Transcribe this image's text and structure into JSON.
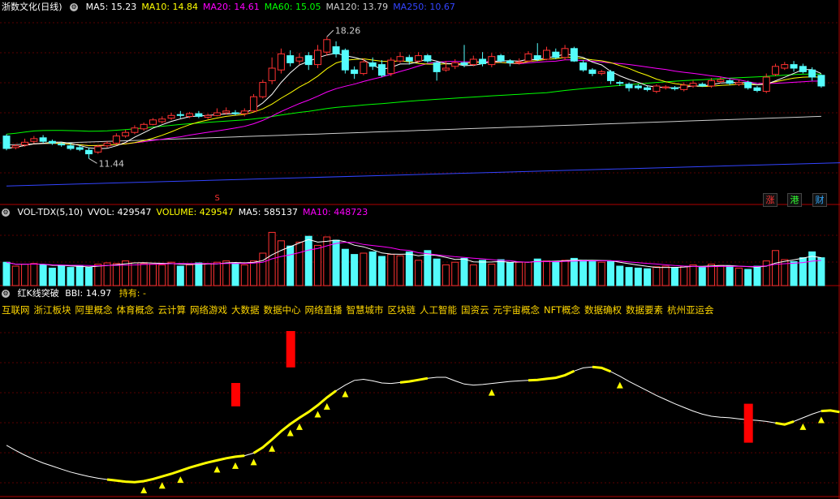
{
  "header": {
    "stock_name": "浙数文化(日线)",
    "ma_labels": [
      {
        "text": "MA5: 15.23",
        "color": "#ffffff"
      },
      {
        "text": "MA10: 14.84",
        "color": "#ffff00"
      },
      {
        "text": "MA20: 14.61",
        "color": "#ff00ff"
      },
      {
        "text": "MA60: 15.05",
        "color": "#00ff00"
      },
      {
        "text": "MA120: 13.79",
        "color": "#cccccc"
      },
      {
        "text": "MA250: 10.67",
        "color": "#3344ff"
      }
    ]
  },
  "volume_header": {
    "title": "VOL-TDX(5,10)",
    "labels": [
      {
        "text": "VVOL: 429547",
        "color": "#ffffff"
      },
      {
        "text": "VOLUME: 429547",
        "color": "#ffff00"
      },
      {
        "text": "MA5: 585137",
        "color": "#ffffff"
      },
      {
        "text": "MA10: 448723",
        "color": "#ff00ff"
      }
    ]
  },
  "indicator_header": {
    "title": "红K线突破",
    "bbi": "BBI: 14.97",
    "hold": "持有: -"
  },
  "concepts": [
    "互联网",
    "浙江板块",
    "阿里概念",
    "体育概念",
    "云计算",
    "网络游戏",
    "大数据",
    "数据中心",
    "网络直播",
    "智慧城市",
    "区块链",
    "人工智能",
    "国资云",
    "元宇宙概念",
    "NFT概念",
    "数据确权",
    "数据要素",
    "杭州亚运会"
  ],
  "annotations": {
    "high": "18.26",
    "low": "11.44",
    "s_marker": "S"
  },
  "badges": [
    {
      "text": "涨",
      "color": "#ff3333"
    },
    {
      "text": "港",
      "color": "#33ff33"
    },
    {
      "text": "财",
      "color": "#33aaff"
    }
  ],
  "chart_data": {
    "type": "candlestick",
    "price_range": [
      9.5,
      19.5
    ],
    "candles": [
      [
        12.7,
        12.0,
        12.8,
        11.9
      ],
      [
        12.05,
        12.15,
        12.25,
        11.95
      ],
      [
        12.2,
        12.35,
        12.55,
        12.1
      ],
      [
        12.4,
        12.55,
        12.7,
        12.3
      ],
      [
        12.6,
        12.4,
        12.75,
        12.3
      ],
      [
        12.4,
        12.3,
        12.5,
        12.2
      ],
      [
        12.25,
        12.2,
        12.35,
        12.1
      ],
      [
        12.15,
        12.0,
        12.3,
        11.9
      ],
      [
        12.05,
        11.95,
        12.2,
        11.85
      ],
      [
        11.9,
        11.7,
        12.05,
        11.44
      ],
      [
        11.8,
        12.1,
        12.2,
        11.7
      ],
      [
        12.15,
        12.3,
        12.4,
        12.05
      ],
      [
        12.3,
        12.7,
        12.85,
        12.2
      ],
      [
        12.7,
        12.9,
        13.05,
        12.6
      ],
      [
        12.9,
        13.15,
        13.3,
        12.8
      ],
      [
        13.1,
        13.35,
        13.45,
        13.0
      ],
      [
        13.35,
        13.6,
        13.7,
        13.3
      ],
      [
        13.5,
        13.65,
        13.8,
        13.4
      ],
      [
        13.7,
        13.85,
        14.0,
        13.6
      ],
      [
        13.9,
        13.85,
        14.1,
        13.7
      ],
      [
        13.8,
        13.95,
        14.05,
        13.7
      ],
      [
        13.95,
        13.8,
        14.1,
        13.7
      ],
      [
        13.75,
        13.85,
        13.95,
        13.65
      ],
      [
        13.85,
        14.0,
        14.25,
        13.8
      ],
      [
        14.0,
        14.1,
        14.3,
        13.9
      ],
      [
        14.0,
        13.95,
        14.15,
        13.85
      ],
      [
        13.95,
        14.1,
        14.25,
        13.8
      ],
      [
        14.1,
        14.9,
        15.05,
        14.0
      ],
      [
        14.9,
        15.7,
        15.85,
        14.8
      ],
      [
        15.8,
        16.5,
        17.1,
        15.6
      ],
      [
        16.4,
        17.3,
        17.6,
        16.2
      ],
      [
        17.2,
        16.8,
        17.5,
        16.6
      ],
      [
        16.9,
        17.1,
        17.35,
        16.7
      ],
      [
        17.2,
        16.7,
        17.4,
        16.4
      ],
      [
        16.7,
        17.5,
        17.8,
        16.5
      ],
      [
        17.4,
        18.1,
        18.26,
        17.2
      ],
      [
        17.7,
        17.3,
        18.0,
        17.1
      ],
      [
        17.5,
        16.4,
        17.6,
        16.2
      ],
      [
        16.4,
        16.2,
        16.6,
        15.9
      ],
      [
        16.2,
        16.85,
        17.05,
        16.1
      ],
      [
        16.8,
        16.6,
        17.1,
        16.4
      ],
      [
        16.7,
        16.1,
        16.95,
        16.0
      ],
      [
        16.2,
        16.95,
        17.1,
        16.05
      ],
      [
        16.9,
        17.15,
        17.4,
        16.8
      ],
      [
        17.1,
        16.9,
        17.25,
        16.7
      ],
      [
        16.9,
        17.2,
        17.4,
        16.8
      ],
      [
        17.2,
        16.9,
        17.3,
        16.8
      ],
      [
        16.8,
        16.3,
        16.9,
        15.8
      ],
      [
        16.4,
        16.5,
        16.9,
        16.3
      ],
      [
        16.6,
        16.8,
        17.0,
        16.45
      ],
      [
        16.8,
        16.7,
        17.8,
        16.55
      ],
      [
        16.7,
        17.0,
        17.2,
        16.6
      ],
      [
        17.0,
        16.75,
        17.4,
        16.6
      ],
      [
        16.7,
        17.15,
        17.35,
        16.55
      ],
      [
        17.2,
        16.9,
        17.3,
        16.8
      ],
      [
        16.9,
        16.8,
        17.0,
        16.6
      ],
      [
        16.8,
        16.85,
        17.05,
        16.7
      ],
      [
        16.9,
        17.3,
        17.45,
        16.85
      ],
      [
        17.2,
        17.0,
        17.9,
        16.9
      ],
      [
        17.0,
        17.5,
        17.7,
        16.95
      ],
      [
        17.4,
        17.1,
        17.6,
        17.0
      ],
      [
        17.1,
        17.6,
        17.8,
        16.95
      ],
      [
        17.6,
        16.9,
        17.7,
        16.85
      ],
      [
        16.8,
        16.4,
        16.95,
        16.3
      ],
      [
        16.4,
        16.2,
        16.5,
        16.05
      ],
      [
        16.2,
        16.3,
        16.4,
        16.1
      ],
      [
        16.3,
        15.8,
        16.4,
        15.6
      ],
      [
        15.7,
        15.65,
        15.8,
        15.5
      ],
      [
        15.6,
        15.4,
        15.7,
        15.2
      ],
      [
        15.5,
        15.4,
        15.6,
        15.3
      ],
      [
        15.4,
        15.3,
        15.5,
        15.2
      ],
      [
        15.2,
        15.5,
        15.6,
        15.1
      ],
      [
        15.4,
        15.45,
        15.55,
        15.3
      ],
      [
        15.4,
        15.35,
        15.5,
        15.25
      ],
      [
        15.3,
        15.55,
        15.7,
        15.2
      ],
      [
        15.5,
        15.65,
        15.8,
        15.4
      ],
      [
        15.6,
        15.5,
        15.7,
        15.45
      ],
      [
        15.5,
        15.8,
        15.95,
        15.4
      ],
      [
        15.75,
        15.85,
        16.0,
        15.65
      ],
      [
        15.8,
        15.65,
        15.9,
        15.55
      ],
      [
        15.6,
        15.7,
        15.85,
        15.5
      ],
      [
        15.7,
        15.4,
        15.8,
        15.3
      ],
      [
        15.4,
        15.25,
        15.5,
        15.15
      ],
      [
        15.2,
        16.0,
        16.2,
        15.1
      ],
      [
        16.15,
        16.6,
        16.75,
        16.05
      ],
      [
        16.5,
        16.7,
        16.85,
        16.4
      ],
      [
        16.7,
        16.5,
        16.9,
        16.3
      ],
      [
        16.6,
        16.3,
        16.75,
        16.2
      ],
      [
        16.4,
        16.0,
        16.55,
        15.8
      ],
      [
        16.1,
        15.5,
        16.15,
        15.4
      ]
    ],
    "ma250": [
      9.9,
      11.2
    ],
    "volume_range": [
      0,
      1000000
    ],
    "volume": [
      360000,
      300000,
      330000,
      340000,
      320000,
      270000,
      300000,
      280000,
      310000,
      280000,
      330000,
      350000,
      340000,
      380000,
      350000,
      340000,
      330000,
      320000,
      360000,
      300000,
      320000,
      350000,
      340000,
      360000,
      380000,
      350000,
      320000,
      380000,
      500000,
      820000,
      690000,
      610000,
      670000,
      760000,
      620000,
      750000,
      700000,
      560000,
      480000,
      500000,
      520000,
      450000,
      480000,
      460000,
      520000,
      390000,
      540000,
      410000,
      320000,
      360000,
      420000,
      320000,
      390000,
      330000,
      400000,
      350000,
      360000,
      360000,
      410000,
      380000,
      370000,
      390000,
      420000,
      390000,
      380000,
      360000,
      370000,
      300000,
      280000,
      270000,
      260000,
      290000,
      300000,
      280000,
      300000,
      320000,
      290000,
      330000,
      310000,
      300000,
      270000,
      250000,
      300000,
      380000,
      540000,
      400000,
      370000,
      430000,
      520000,
      429547
    ],
    "bbi_range": [
      13.0,
      19.5
    ],
    "bbi": [
      14.6,
      14.4,
      14.22,
      14.06,
      13.92,
      13.8,
      13.68,
      13.57,
      13.48,
      13.4,
      13.33,
      13.28,
      13.24,
      13.2,
      13.18,
      13.22,
      13.3,
      13.4,
      13.5,
      13.62,
      13.74,
      13.84,
      13.94,
      14.02,
      14.1,
      14.16,
      14.2,
      14.3,
      14.52,
      14.82,
      15.14,
      15.42,
      15.66,
      15.88,
      16.14,
      16.44,
      16.7,
      16.92,
      17.1,
      17.14,
      17.08,
      17.0,
      16.98,
      17.02,
      17.06,
      17.12,
      17.18,
      17.22,
      17.22,
      17.08,
      16.96,
      16.92,
      16.94,
      16.98,
      17.02,
      17.06,
      17.08,
      17.1,
      17.12,
      17.16,
      17.2,
      17.3,
      17.46,
      17.58,
      17.62,
      17.58,
      17.44,
      17.26,
      17.06,
      16.88,
      16.7,
      16.52,
      16.36,
      16.2,
      16.06,
      15.92,
      15.8,
      15.72,
      15.68,
      15.66,
      15.62,
      15.58,
      15.56,
      15.52,
      15.46,
      15.4,
      15.52,
      15.66,
      15.8,
      15.92,
      15.94,
      15.88
    ],
    "hold_segments": [
      [
        11,
        26
      ],
      [
        27,
        36
      ],
      [
        43,
        46
      ],
      [
        57,
        62
      ],
      [
        64,
        66
      ],
      [
        84,
        86
      ],
      [
        89,
        92
      ]
    ],
    "signal_bars": [
      [
        25,
        16.1,
        17.0
      ],
      [
        31,
        17.6,
        19.0
      ],
      [
        81,
        14.7,
        16.2
      ]
    ],
    "triangles": [
      15,
      17,
      19,
      23,
      25,
      27,
      29,
      31,
      32,
      34,
      35,
      37,
      53,
      67,
      87,
      89
    ]
  }
}
